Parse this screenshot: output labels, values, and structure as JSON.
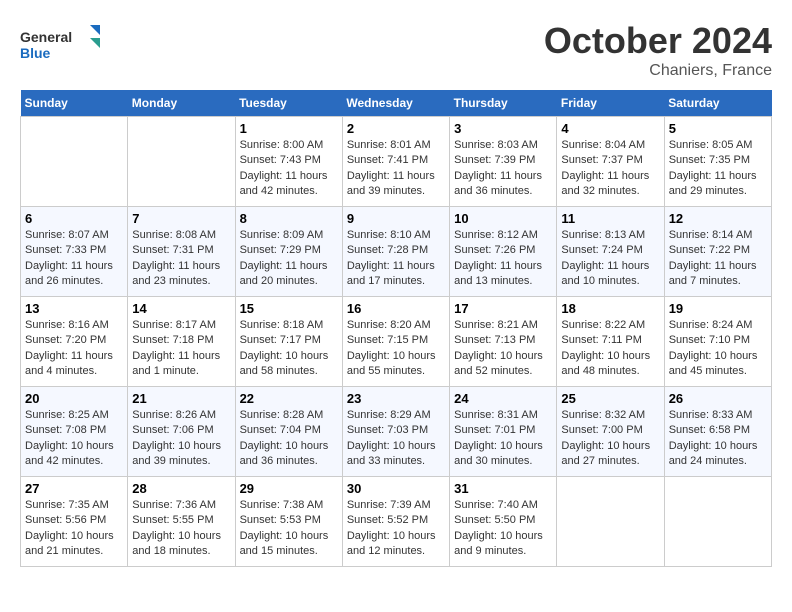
{
  "header": {
    "logo_general": "General",
    "logo_blue": "Blue",
    "month": "October 2024",
    "location": "Chaniers, France"
  },
  "weekdays": [
    "Sunday",
    "Monday",
    "Tuesday",
    "Wednesday",
    "Thursday",
    "Friday",
    "Saturday"
  ],
  "weeks": [
    [
      {
        "day": "",
        "info": ""
      },
      {
        "day": "",
        "info": ""
      },
      {
        "day": "1",
        "info": "Sunrise: 8:00 AM\nSunset: 7:43 PM\nDaylight: 11 hours and 42 minutes."
      },
      {
        "day": "2",
        "info": "Sunrise: 8:01 AM\nSunset: 7:41 PM\nDaylight: 11 hours and 39 minutes."
      },
      {
        "day": "3",
        "info": "Sunrise: 8:03 AM\nSunset: 7:39 PM\nDaylight: 11 hours and 36 minutes."
      },
      {
        "day": "4",
        "info": "Sunrise: 8:04 AM\nSunset: 7:37 PM\nDaylight: 11 hours and 32 minutes."
      },
      {
        "day": "5",
        "info": "Sunrise: 8:05 AM\nSunset: 7:35 PM\nDaylight: 11 hours and 29 minutes."
      }
    ],
    [
      {
        "day": "6",
        "info": "Sunrise: 8:07 AM\nSunset: 7:33 PM\nDaylight: 11 hours and 26 minutes."
      },
      {
        "day": "7",
        "info": "Sunrise: 8:08 AM\nSunset: 7:31 PM\nDaylight: 11 hours and 23 minutes."
      },
      {
        "day": "8",
        "info": "Sunrise: 8:09 AM\nSunset: 7:29 PM\nDaylight: 11 hours and 20 minutes."
      },
      {
        "day": "9",
        "info": "Sunrise: 8:10 AM\nSunset: 7:28 PM\nDaylight: 11 hours and 17 minutes."
      },
      {
        "day": "10",
        "info": "Sunrise: 8:12 AM\nSunset: 7:26 PM\nDaylight: 11 hours and 13 minutes."
      },
      {
        "day": "11",
        "info": "Sunrise: 8:13 AM\nSunset: 7:24 PM\nDaylight: 11 hours and 10 minutes."
      },
      {
        "day": "12",
        "info": "Sunrise: 8:14 AM\nSunset: 7:22 PM\nDaylight: 11 hours and 7 minutes."
      }
    ],
    [
      {
        "day": "13",
        "info": "Sunrise: 8:16 AM\nSunset: 7:20 PM\nDaylight: 11 hours and 4 minutes."
      },
      {
        "day": "14",
        "info": "Sunrise: 8:17 AM\nSunset: 7:18 PM\nDaylight: 11 hours and 1 minute."
      },
      {
        "day": "15",
        "info": "Sunrise: 8:18 AM\nSunset: 7:17 PM\nDaylight: 10 hours and 58 minutes."
      },
      {
        "day": "16",
        "info": "Sunrise: 8:20 AM\nSunset: 7:15 PM\nDaylight: 10 hours and 55 minutes."
      },
      {
        "day": "17",
        "info": "Sunrise: 8:21 AM\nSunset: 7:13 PM\nDaylight: 10 hours and 52 minutes."
      },
      {
        "day": "18",
        "info": "Sunrise: 8:22 AM\nSunset: 7:11 PM\nDaylight: 10 hours and 48 minutes."
      },
      {
        "day": "19",
        "info": "Sunrise: 8:24 AM\nSunset: 7:10 PM\nDaylight: 10 hours and 45 minutes."
      }
    ],
    [
      {
        "day": "20",
        "info": "Sunrise: 8:25 AM\nSunset: 7:08 PM\nDaylight: 10 hours and 42 minutes."
      },
      {
        "day": "21",
        "info": "Sunrise: 8:26 AM\nSunset: 7:06 PM\nDaylight: 10 hours and 39 minutes."
      },
      {
        "day": "22",
        "info": "Sunrise: 8:28 AM\nSunset: 7:04 PM\nDaylight: 10 hours and 36 minutes."
      },
      {
        "day": "23",
        "info": "Sunrise: 8:29 AM\nSunset: 7:03 PM\nDaylight: 10 hours and 33 minutes."
      },
      {
        "day": "24",
        "info": "Sunrise: 8:31 AM\nSunset: 7:01 PM\nDaylight: 10 hours and 30 minutes."
      },
      {
        "day": "25",
        "info": "Sunrise: 8:32 AM\nSunset: 7:00 PM\nDaylight: 10 hours and 27 minutes."
      },
      {
        "day": "26",
        "info": "Sunrise: 8:33 AM\nSunset: 6:58 PM\nDaylight: 10 hours and 24 minutes."
      }
    ],
    [
      {
        "day": "27",
        "info": "Sunrise: 7:35 AM\nSunset: 5:56 PM\nDaylight: 10 hours and 21 minutes."
      },
      {
        "day": "28",
        "info": "Sunrise: 7:36 AM\nSunset: 5:55 PM\nDaylight: 10 hours and 18 minutes."
      },
      {
        "day": "29",
        "info": "Sunrise: 7:38 AM\nSunset: 5:53 PM\nDaylight: 10 hours and 15 minutes."
      },
      {
        "day": "30",
        "info": "Sunrise: 7:39 AM\nSunset: 5:52 PM\nDaylight: 10 hours and 12 minutes."
      },
      {
        "day": "31",
        "info": "Sunrise: 7:40 AM\nSunset: 5:50 PM\nDaylight: 10 hours and 9 minutes."
      },
      {
        "day": "",
        "info": ""
      },
      {
        "day": "",
        "info": ""
      }
    ]
  ]
}
